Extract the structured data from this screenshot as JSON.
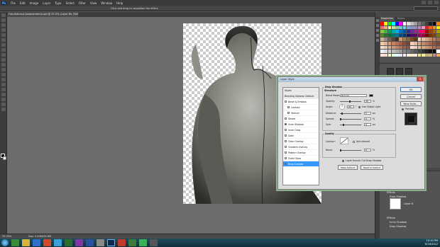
{
  "menubar": {
    "logo": "Ps",
    "items": [
      "File",
      "Edit",
      "Image",
      "Layer",
      "Type",
      "Select",
      "Filter",
      "View",
      "Window",
      "Help"
    ]
  },
  "options_bar": {
    "hint": "Click and drag to reposition the effect."
  },
  "document": {
    "tab_title": "Futuristiceva-kalanemtemt.psd @ 33.3% (Layer 6h, RGB/8)"
  },
  "status_bar": {
    "zoom": "33.33%",
    "doc_info": "Doc: 3.43M/35.6M"
  },
  "right_panel": {
    "tabs": [
      "Swatches",
      "Styles"
    ]
  },
  "layers": {
    "items": [
      {
        "label": "Effects"
      },
      {
        "label": "Drop Shadow"
      },
      {
        "label": "Layer 6"
      },
      {
        "label": "Effects"
      },
      {
        "label": "Inner Shadow"
      },
      {
        "label": "Drop Shadow"
      }
    ]
  },
  "layer_style_dialog": {
    "title": "Layer Style",
    "styles": [
      {
        "label": "Styles",
        "checkbox": false,
        "header": true
      },
      {
        "label": "Blending Options: Default",
        "checkbox": false,
        "header": true
      },
      {
        "label": "Bevel & Emboss",
        "checkbox": true,
        "checked": false
      },
      {
        "label": "Contour",
        "checkbox": true,
        "checked": false
      },
      {
        "label": "Texture",
        "checkbox": true,
        "checked": false
      },
      {
        "label": "Stroke",
        "checkbox": true,
        "checked": false
      },
      {
        "label": "Inner Shadow",
        "checkbox": true,
        "checked": true
      },
      {
        "label": "Inner Glow",
        "checkbox": true,
        "checked": false
      },
      {
        "label": "Satin",
        "checkbox": true,
        "checked": false
      },
      {
        "label": "Color Overlay",
        "checkbox": true,
        "checked": false
      },
      {
        "label": "Gradient Overlay",
        "checkbox": true,
        "checked": false
      },
      {
        "label": "Pattern Overlay",
        "checkbox": true,
        "checked": false
      },
      {
        "label": "Outer Glow",
        "checkbox": true,
        "checked": false
      },
      {
        "label": "Drop Shadow",
        "checkbox": true,
        "checked": true,
        "selected": true
      }
    ],
    "section_title": "Drop Shadow",
    "structure": {
      "title": "Structure",
      "blend_mode_label": "Blend Mode:",
      "blend_mode_value": "Normal",
      "opacity_label": "Opacity:",
      "opacity_value": "45",
      "angle_label": "Angle:",
      "angle_value": "90",
      "global_light_label": "Use Global Light",
      "distance_label": "Distance:",
      "distance_value": "5",
      "spread_label": "Spread:",
      "spread_value": "0",
      "size_label": "Size:",
      "size_value": "9",
      "unit_percent": "%",
      "unit_px": "px",
      "unit_deg": "°"
    },
    "quality": {
      "title": "Quality",
      "contour_label": "Contour:",
      "anti_aliased_label": "Anti-aliased",
      "noise_label": "Noise:",
      "noise_value": "0",
      "knockout_label": "Layer Knocks Out Drop Shadow"
    },
    "make_default": "Make Default",
    "reset_default": "Reset to Default",
    "buttons": {
      "ok": "OK",
      "cancel": "Cancel",
      "new_style": "New Style...",
      "preview": "Preview"
    }
  },
  "tray": {
    "time": "10:10 PM",
    "date": "8/16/2012"
  },
  "colors": {
    "ps_dark": "#3a3a3a",
    "selection_blue": "#3399ff",
    "dialog_bg": "#dcdcdc"
  }
}
